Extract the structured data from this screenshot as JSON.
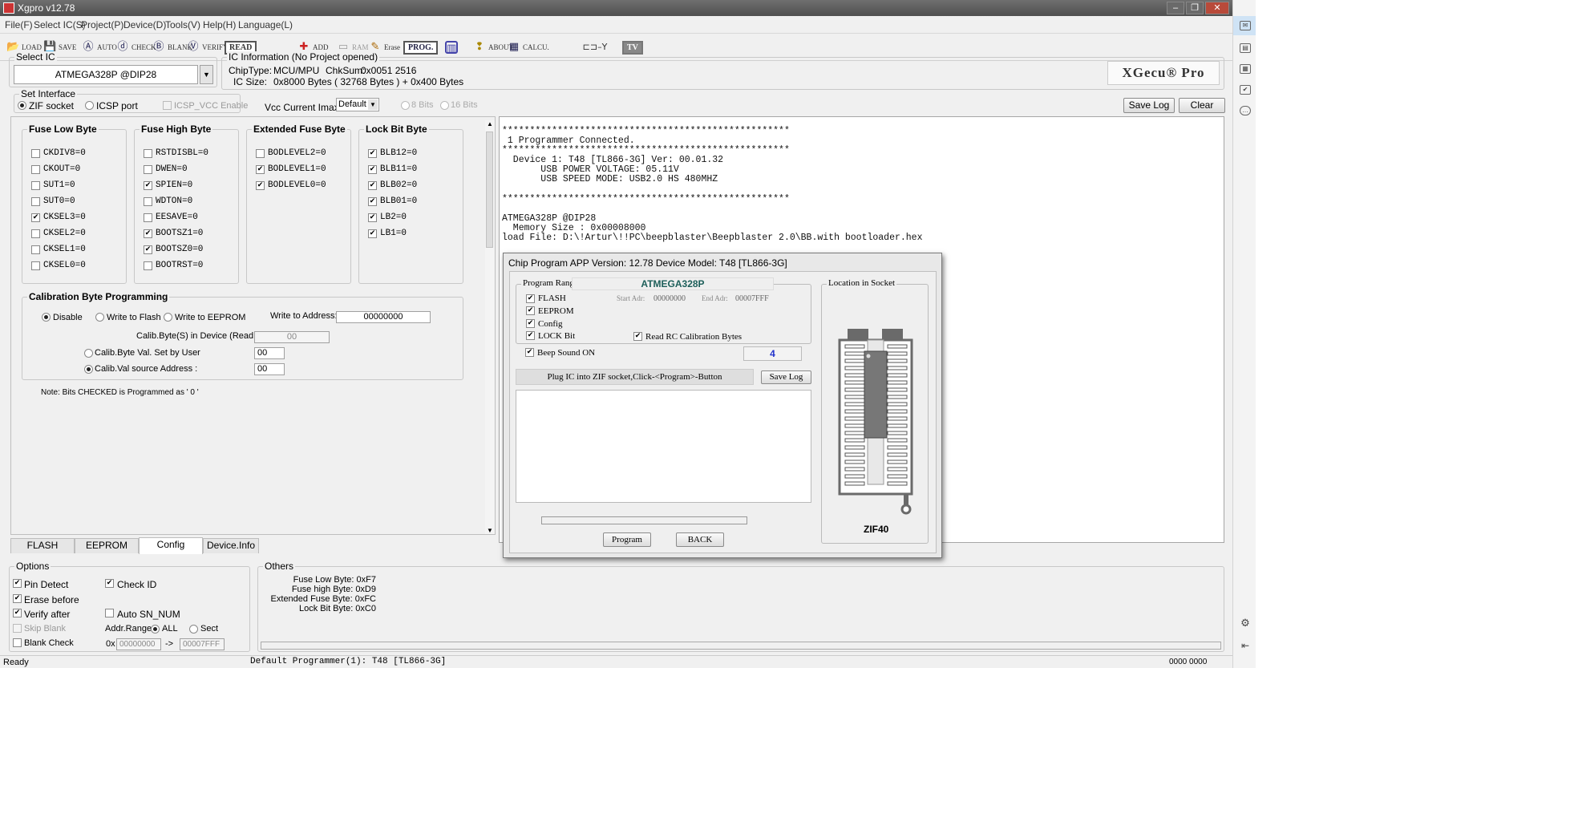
{
  "window": {
    "title": "Xgpro v12.78",
    "controls": [
      "–",
      "❐",
      "✕"
    ]
  },
  "menu": [
    "File(F)",
    "Select IC(S)",
    "Project(P)",
    "Device(D)",
    "Tools(V)",
    "Help(H)",
    "Language(L)"
  ],
  "toolbar": {
    "load": "LOAD",
    "save": "SAVE",
    "auto": "AUTO",
    "check": "CHECK",
    "blank": "BLANK",
    "verify": "VERIFY",
    "read": "READ",
    "add": "ADD",
    "ram": "RAM",
    "erase": "Erase",
    "prog": "PROG.",
    "about": "ABOUT",
    "calcu": "CALCU.",
    "tv": "TV"
  },
  "select_ic": {
    "legend": "Select IC",
    "value": "ATMEGA328P @DIP28"
  },
  "ic_info": {
    "legend": "IC Information (No Project opened)",
    "chiptype_label": "ChipType:",
    "chiptype": "MCU/MPU",
    "chksum_label": "ChkSum:",
    "chksum": "0x0051 2516",
    "icsize_label": "IC Size:",
    "icsize": "0x8000 Bytes ( 32768 Bytes ) + 0x400 Bytes",
    "logo": "XGecu® Pro"
  },
  "interface": {
    "legend": "Set Interface",
    "zif": "ZIF socket",
    "icsp": "ICSP port",
    "icsp_vcc": "ICSP_VCC Enable",
    "vcc_label": "Vcc Current Imax:",
    "vcc_value": "Default",
    "bits8": "8 Bits",
    "bits16": "16 Bits"
  },
  "log_buttons": {
    "save": "Save Log",
    "clear": "Clear"
  },
  "fuses": {
    "low": {
      "title": "Fuse Low Byte",
      "items": [
        "CKDIV8=0",
        "CKOUT=0",
        "SUT1=0",
        "SUT0=0",
        "CKSEL3=0",
        "CKSEL2=0",
        "CKSEL1=0",
        "CKSEL0=0"
      ]
    },
    "high": {
      "title": "Fuse High Byte",
      "items": [
        "RSTDISBL=0",
        "DWEN=0",
        "SPIEN=0",
        "WDTON=0",
        "EESAVE=0",
        "BOOTSZ1=0",
        "BOOTSZ0=0",
        "BOOTRST=0"
      ]
    },
    "ext": {
      "title": "Extended Fuse Byte",
      "items": [
        "BODLEVEL2=0",
        "BODLEVEL1=0",
        "BODLEVEL0=0"
      ]
    },
    "lock": {
      "title": "Lock Bit Byte",
      "items": [
        "BLB12=0",
        "BLB11=0",
        "BLB02=0",
        "BLB01=0",
        "LB2=0",
        "LB1=0"
      ]
    }
  },
  "calib": {
    "title": "Calibration Byte Programming",
    "disable": "Disable",
    "flash": "Write to Flash",
    "eeprom": "Write to EEPROM",
    "addr_label": "Write to Address: 0x",
    "addr_value": "00000000",
    "in_device_label": "Calib.Byte(S) in Device (Read Only) :",
    "in_device_value": "00",
    "user_label": "Calib.Byte Val. Set by User",
    "user_value": "00",
    "src_label": "Calib.Val source Address :",
    "src_value": "00"
  },
  "note": "Note: Bits CHECKED is Programmed as ' 0 '",
  "tabs": [
    "FLASH",
    "EEPROM",
    "Config",
    "Device.Info"
  ],
  "log_lines": [
    "****************************************************",
    " 1 Programmer Connected.",
    "****************************************************",
    "  Device 1: T48 [TL866-3G] Ver: 00.01.32",
    "       USB POWER VOLTAGE: 05.11V",
    "       USB SPEED MODE: USB2.0 HS 480MHZ",
    "",
    "****************************************************",
    "",
    "ATMEGA328P @DIP28",
    "  Memory Size : 0x00008000",
    "load File: D:\\!Artur\\!!PC\\beepblaster\\Beepblaster 2.0\\BB.with bootloader.hex"
  ],
  "dialog": {
    "title": "Chip Program   APP Version: 12.78 Device Model: T48 [TL866-3G]",
    "range_legend": "Program Range",
    "chip": "ATMEGA328P",
    "flash": "FLASH",
    "eeprom": "EEPROM",
    "config": "Config",
    "lock": "LOCK Bit",
    "start_label": "Start Adr:",
    "start_value": "00000000",
    "end_label": "End Adr:",
    "end_value": "00007FFF",
    "read_rc": "Read RC Calibration Bytes",
    "beep": "Beep Sound ON",
    "count": "4",
    "status": "Plug IC into ZIF socket,Click-<Program>-Button",
    "save_log": "Save Log",
    "socket_legend": "Location in Socket",
    "zif": "ZIF40",
    "program": "Program",
    "back": "BACK"
  },
  "options": {
    "legend": "Options",
    "pin_detect": "Pin Detect",
    "check_id": "Check ID",
    "erase_before": "Erase before",
    "verify_after": "Verify after",
    "auto_sn": "Auto SN_NUM",
    "skip_blank": "Skip Blank",
    "addr_range": "Addr.Range:",
    "all": "ALL",
    "sect": "Sect",
    "blank_check": "Blank Check",
    "hex_prefix": "0x",
    "range_start": "00000000",
    "arrow": "->",
    "range_end": "00007FFF"
  },
  "others": {
    "legend": "Others",
    "lines": [
      "Fuse Low Byte: 0xF7",
      "Fuse high Byte: 0xD9",
      "Extended Fuse Byte: 0xFC",
      "Lock Bit Byte: 0xC0"
    ]
  },
  "status": {
    "left": "Ready",
    "center": "Default Programmer(1): T48 [TL866-3G]",
    "right": "0000 0000"
  }
}
